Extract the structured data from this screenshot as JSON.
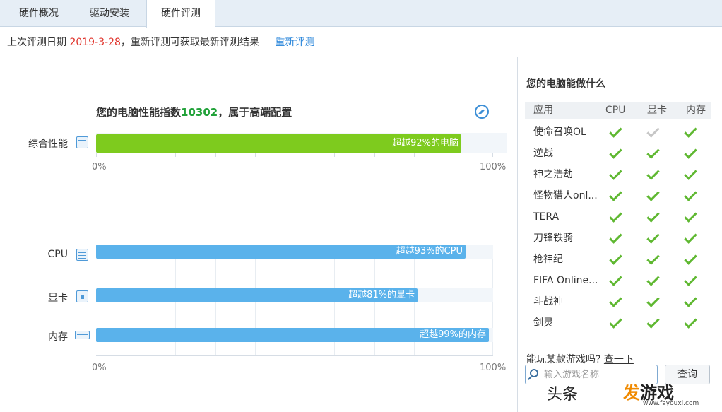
{
  "tabs": [
    {
      "label": "硬件概况",
      "active": false
    },
    {
      "label": "驱动安装",
      "active": false
    },
    {
      "label": "硬件评测",
      "active": true
    }
  ],
  "info": {
    "prefix": "上次评测日期",
    "date": "2019-3-28",
    "suffix": "，重新评测可获取最新评测结果",
    "retest_link": "重新评测"
  },
  "performance": {
    "title_prefix": "您的电脑性能指数",
    "score": "10302",
    "title_suffix": "，属于高端配置",
    "overall": {
      "label": "综合性能",
      "percent": 92,
      "text": "超越92%的电脑"
    },
    "components": [
      {
        "label": "CPU",
        "percent": 93,
        "text": "超越93%的CPU"
      },
      {
        "label": "显卡",
        "percent": 81,
        "text": "超越81%的显卡"
      },
      {
        "label": "内存",
        "percent": 99,
        "text": "超越99%的内存"
      }
    ],
    "axis": {
      "min_label": "0%",
      "max_label": "100%"
    }
  },
  "capability": {
    "title": "您的电脑能做什么",
    "columns": [
      "应用",
      "CPU",
      "显卡",
      "内存"
    ],
    "games": [
      {
        "name": "使命召唤OL",
        "cpu": true,
        "gpu": false,
        "mem": true
      },
      {
        "name": "逆战",
        "cpu": true,
        "gpu": true,
        "mem": true
      },
      {
        "name": "神之浩劫",
        "cpu": true,
        "gpu": true,
        "mem": true
      },
      {
        "name": "怪物猎人onl...",
        "cpu": true,
        "gpu": true,
        "mem": true
      },
      {
        "name": "TERA",
        "cpu": true,
        "gpu": true,
        "mem": true
      },
      {
        "name": "刀锋铁骑",
        "cpu": true,
        "gpu": true,
        "mem": true
      },
      {
        "name": "枪神纪",
        "cpu": true,
        "gpu": true,
        "mem": true
      },
      {
        "name": "FIFA Online...",
        "cpu": true,
        "gpu": true,
        "mem": true
      },
      {
        "name": "斗战神",
        "cpu": true,
        "gpu": true,
        "mem": true
      },
      {
        "name": "剑灵",
        "cpu": true,
        "gpu": true,
        "mem": true
      }
    ],
    "ask_prefix": "能玩某款游戏吗?",
    "ask_link": "查一下",
    "search_placeholder": "输入游戏名称",
    "query_button": "查询"
  },
  "watermark": {
    "left": "头条",
    "brand_hl": "发",
    "brand": "游戏",
    "url": "www.fayouxi.com"
  }
}
